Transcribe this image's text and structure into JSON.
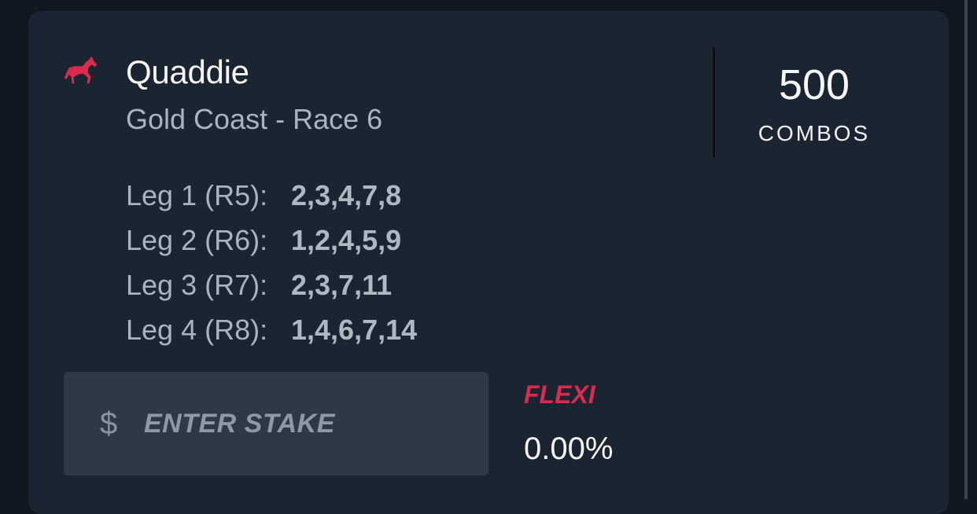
{
  "bet": {
    "type": "Quaddie",
    "event": "Gold Coast - Race 6",
    "icon": "horse-icon",
    "accent_color": "#d92b4d"
  },
  "combos": {
    "value": "500",
    "label": "COMBOS"
  },
  "legs": [
    {
      "label": "Leg 1 (R5):",
      "runners": "2,3,4,7,8"
    },
    {
      "label": "Leg 2 (R6):",
      "runners": "1,2,4,5,9"
    },
    {
      "label": "Leg 3 (R7):",
      "runners": "2,3,7,11"
    },
    {
      "label": "Leg 4 (R8):",
      "runners": "1,4,6,7,14"
    }
  ],
  "stake": {
    "currency_symbol": "$",
    "placeholder": "ENTER STAKE",
    "value": ""
  },
  "flexi": {
    "label": "FLEXI",
    "value": "0.00%"
  }
}
